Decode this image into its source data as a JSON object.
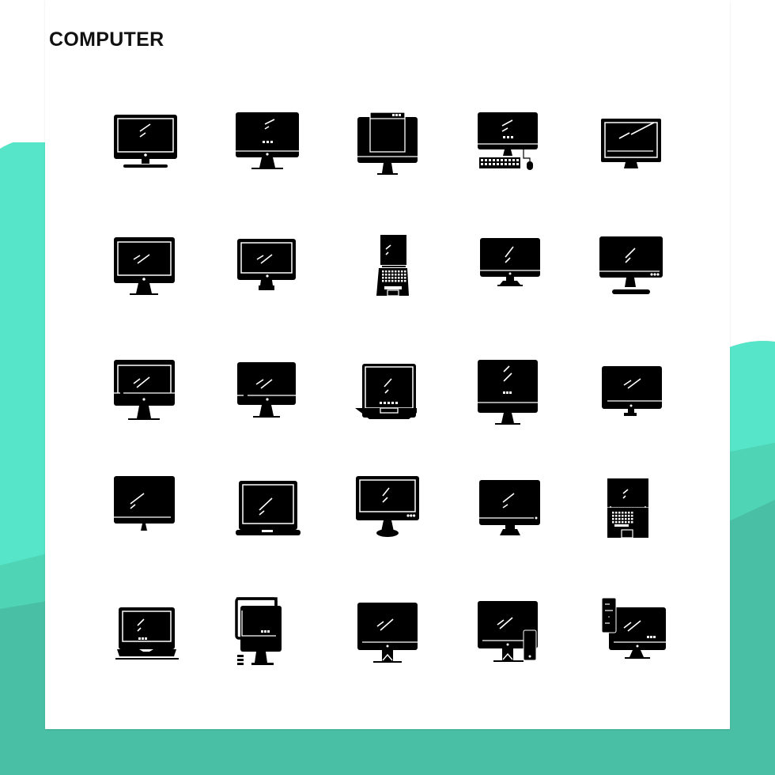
{
  "title": "COMPUTER",
  "colors": {
    "teal_light": "#56e5c8",
    "teal_mid": "#4fd4b6",
    "teal_dark": "#49bfa6",
    "card": "#ffffff",
    "icon": "#000000"
  },
  "icons": [
    {
      "name": "monitor-framed-screen-icon"
    },
    {
      "name": "monitor-chin-dots-icon"
    },
    {
      "name": "monitor-window-app-icon"
    },
    {
      "name": "desktop-keyboard-mouse-icon"
    },
    {
      "name": "monitor-widescreen-icon"
    },
    {
      "name": "monitor-framed-icon"
    },
    {
      "name": "monitor-framed-small-stand-icon"
    },
    {
      "name": "laptop-open-keyboard-icon"
    },
    {
      "name": "monitor-chin-icon"
    },
    {
      "name": "monitor-dots-stand-icon"
    },
    {
      "name": "monitor-partial-frame-icon"
    },
    {
      "name": "monitor-split-chin-icon"
    },
    {
      "name": "laptop-framed-icon"
    },
    {
      "name": "monitor-dots-chin-icon"
    },
    {
      "name": "monitor-compact-icon"
    },
    {
      "name": "monitor-slim-stand-icon"
    },
    {
      "name": "laptop-icon"
    },
    {
      "name": "monitor-round-base-icon"
    },
    {
      "name": "monitor-indicator-icon"
    },
    {
      "name": "laptop-flat-keyboard-icon"
    },
    {
      "name": "laptop-dots-icon"
    },
    {
      "name": "monitor-sync-windows-icon"
    },
    {
      "name": "monitor-stand-arrow-icon"
    },
    {
      "name": "monitor-phone-icon"
    },
    {
      "name": "desktop-tower-icon"
    }
  ]
}
